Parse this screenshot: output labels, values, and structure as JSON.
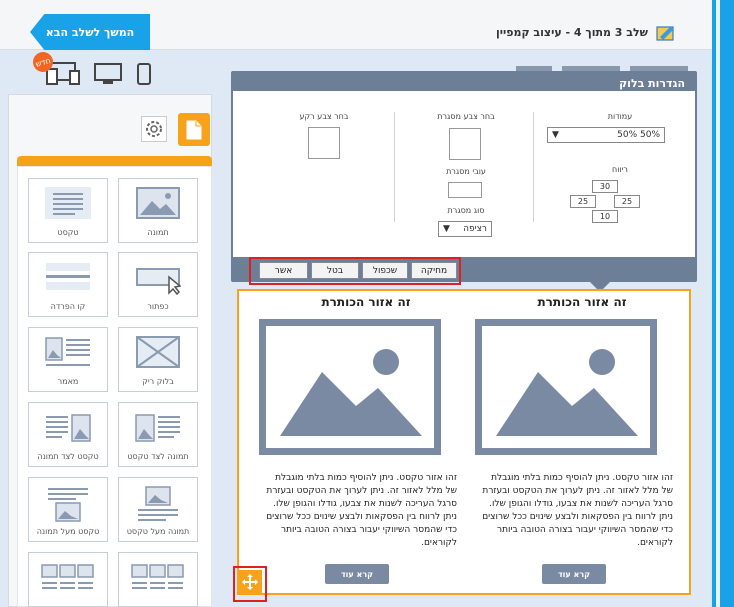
{
  "header": {
    "next_button": "המשך לשלב הבא",
    "step_title": "שלב 3 מתוך 4 - עיצוב קמפיין"
  },
  "devices": {
    "new_badge": "חדש"
  },
  "sidebar": {
    "tiles": [
      {
        "label": "תמונה"
      },
      {
        "label": "טקסט"
      },
      {
        "label": "כפתור"
      },
      {
        "label": "קו הפרדה"
      },
      {
        "label": "בלוק ריק"
      },
      {
        "label": "מאמר"
      },
      {
        "label": "תמונה לצד טקסט"
      },
      {
        "label": "טקסט לצד תמונה"
      },
      {
        "label": "תמונה מעל טקסט"
      },
      {
        "label": "טקסט מעל תמונה"
      }
    ]
  },
  "settings": {
    "title": "הגדרות בלוק",
    "columns_label": "עמודות",
    "columns_value": "50% 50%",
    "spacing_label": "ריווח",
    "spacing_top": "30",
    "spacing_left": "25",
    "spacing_right": "25",
    "spacing_bottom": "10",
    "border_color_label": "בחר צבע מסגרת",
    "border_width_label": "עובי מסגרת",
    "border_type_label": "סוג מסגרת",
    "border_type_value": "רציפה",
    "bg_color_label": "בחר צבע רקע",
    "buttons": {
      "delete": "מחיקה",
      "duplicate": "שכפול",
      "cancel": "בטל",
      "confirm": "אשר"
    }
  },
  "block": {
    "heading_right": "זה אזור הכותרת",
    "heading_left": "זה אזור הכותרת",
    "paragraph": "זהו אזור טקסט. ניתן להוסיף כמות בלתי מוגבלת של מלל לאזור זה. ניתן לערוך את הטקסט ובעזרת סרגל העריכה לשנות את צבעו, גודלו והגופן שלו. ניתן לרווח בין הפסקאות ולבצע שינוים ככל שרוצים כדי שהמסר השיווקי יעבור בצורה הטובה ביותר לקוראים.",
    "read_more": "קרא עוד"
  }
}
